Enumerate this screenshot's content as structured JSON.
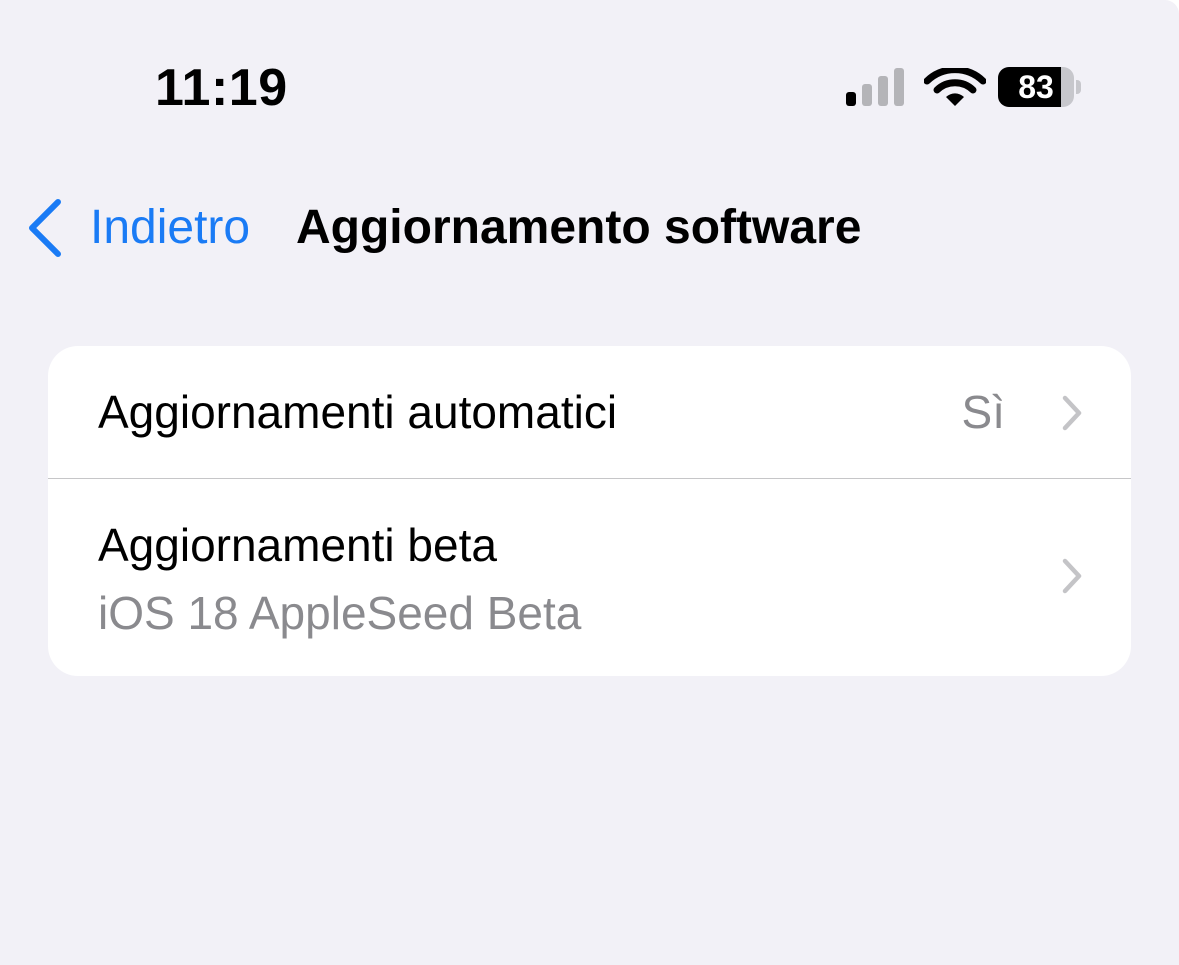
{
  "status_bar": {
    "time": "11:19",
    "battery_level": "83",
    "signal_bars_active": 1,
    "signal_bars_total": 4,
    "icons": [
      "cellular-signal-icon",
      "wifi-icon",
      "battery-icon"
    ]
  },
  "nav": {
    "back_label": "Indietro",
    "title": "Aggiornamento software"
  },
  "settings": {
    "rows": [
      {
        "title": "Aggiornamenti automatici",
        "value": "Sì"
      },
      {
        "title": "Aggiornamenti beta",
        "subtitle": "iOS 18 AppleSeed Beta"
      }
    ]
  },
  "colors": {
    "background": "#f2f1f7",
    "card": "#ffffff",
    "accent": "#1a7bf5",
    "secondary_text": "#8a8a8e",
    "separator": "#c6c6c8"
  }
}
